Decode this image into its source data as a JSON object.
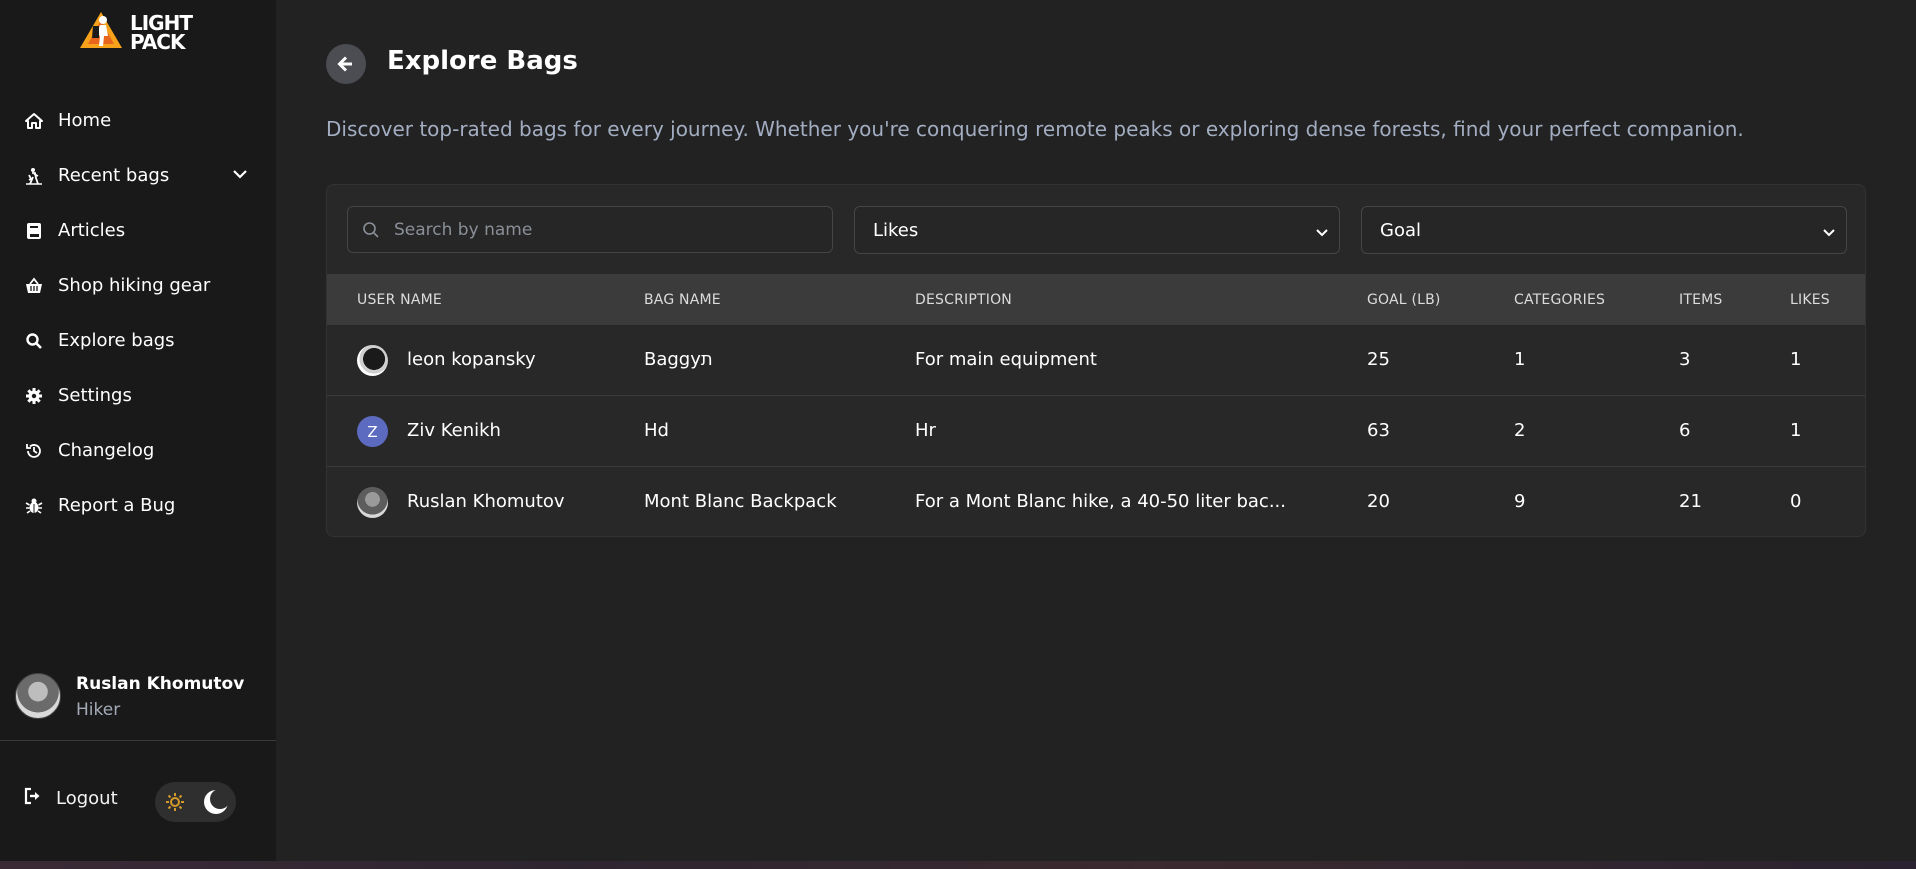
{
  "app": {
    "logo_line1": "LIGHT",
    "logo_line2": "PACK"
  },
  "sidebar": {
    "items": [
      {
        "label": "Home",
        "icon": "home-icon"
      },
      {
        "label": "Recent bags",
        "icon": "hiker-icon"
      },
      {
        "label": "Articles",
        "icon": "book-icon"
      },
      {
        "label": "Shop hiking gear",
        "icon": "basket-icon"
      },
      {
        "label": "Explore bags",
        "icon": "search-icon"
      },
      {
        "label": "Settings",
        "icon": "gear-icon"
      },
      {
        "label": "Changelog",
        "icon": "history-icon"
      },
      {
        "label": "Report a Bug",
        "icon": "bug-icon"
      }
    ],
    "user": {
      "name": "Ruslan Khomutov",
      "role": "Hiker"
    },
    "logout_label": "Logout"
  },
  "page": {
    "title": "Explore Bags",
    "subtitle": "Discover top-rated bags for every journey. Whether you're conquering remote peaks or exploring dense forests, find your perfect companion."
  },
  "filters": {
    "search_placeholder": "Search by name",
    "sort_value": "Likes",
    "goal_value": "Goal"
  },
  "table": {
    "headers": [
      "USER NAME",
      "BAG NAME",
      "DESCRIPTION",
      "GOAL (LB)",
      "CATEGORIES",
      "ITEMS",
      "LIKES"
    ],
    "rows": [
      {
        "avatar_letter": "",
        "user": "leon kopansky",
        "bag": "Baggyת",
        "description": "For main equipment",
        "goal": "25",
        "categories": "1",
        "items": "3",
        "likes": "1"
      },
      {
        "avatar_letter": "Z",
        "user": "Ziv Kenikh",
        "bag": "Hd",
        "description": "Hr",
        "goal": "63",
        "categories": "2",
        "items": "6",
        "likes": "1"
      },
      {
        "avatar_letter": "",
        "user": "Ruslan Khomutov",
        "bag": "Mont Blanc Backpack",
        "description": "For a Mont Blanc hike, a 40-50 liter bac...",
        "goal": "20",
        "categories": "9",
        "items": "21",
        "likes": "0"
      }
    ]
  },
  "colors": {
    "background": "#222222",
    "sidebar": "#191919",
    "accent_avatar": "#5c6bc0",
    "subtitle": "#a3adc2"
  }
}
